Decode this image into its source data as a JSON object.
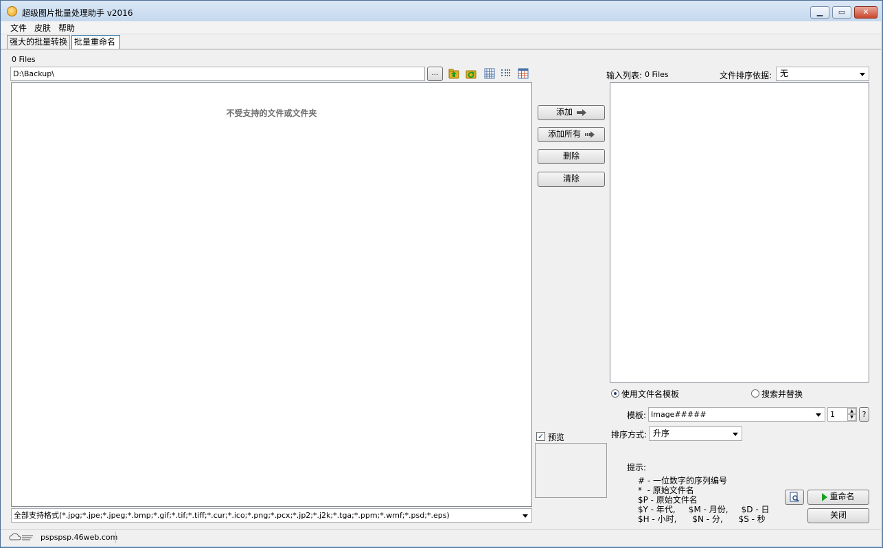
{
  "window": {
    "title": "超级图片批量处理助手  v2016"
  },
  "menu": [
    "文件",
    "皮肤",
    "帮助"
  ],
  "tabs": [
    {
      "label": "强大的批量转换",
      "active": false
    },
    {
      "label": "批量重命名",
      "active": true
    }
  ],
  "left": {
    "file_count": "0 Files",
    "path": "D:\\Backup\\",
    "browse_label": "...",
    "empty_message": "不受支持的文件或文件夹",
    "filter": "全部支持格式(*.jpg;*.jpe;*.jpeg;*.bmp;*.gif;*.tif;*.tiff;*.cur;*.ico;*.png;*.pcx;*.jp2;*.j2k;*.tga;*.ppm;*.wmf;*.psd;*.eps)"
  },
  "middle": {
    "add_label": "添加",
    "add_all_label": "添加所有",
    "delete_label": "删除",
    "clear_label": "清除",
    "preview_label": "预览",
    "preview_checked": true
  },
  "right": {
    "input_list_label": "输入列表:",
    "input_count": "0 Files",
    "sort_by_label": "文件排序依据:",
    "sort_by_value": "无",
    "mode_template_label": "使用文件名模板",
    "mode_replace_label": "搜索并替换",
    "template_label": "模板:",
    "template_value": "Image#####",
    "start_number": "1",
    "help_label": "?",
    "order_label": "排序方式:",
    "order_value": "升序",
    "hint_title": "提示:",
    "hints": [
      "# - 一位数字的序列编号",
      "*  - 原始文件名",
      "$P - 原始文件名",
      "$Y - 年代,     $M - 月份,     $D - 日",
      "$H - 小时,      $N - 分,      $S - 秒"
    ],
    "rename_label": "重命名",
    "close_label": "关闭"
  },
  "status": {
    "site": "pspspsp.46web.com"
  },
  "colors": {
    "title_bg": "#c4d8ee",
    "tab_active_border": "#3c7fb1",
    "client_bg": "#f0f0f0"
  }
}
